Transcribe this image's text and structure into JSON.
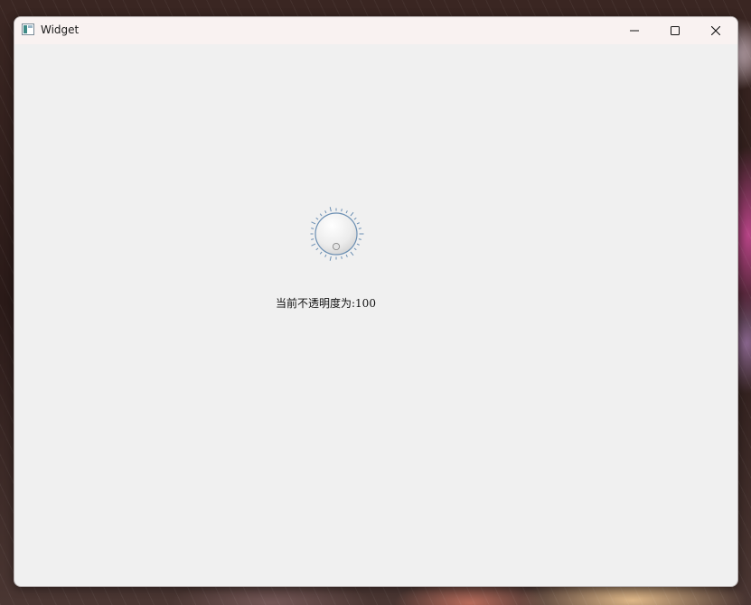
{
  "window": {
    "title": "Widget",
    "buttons": {
      "minimize": "minimize",
      "maximize": "maximize",
      "close": "close"
    }
  },
  "dial": {
    "value": 100,
    "min": 0,
    "max": 100,
    "icon": "dial-knob"
  },
  "label": {
    "text": "当前不透明度为:100"
  },
  "colors": {
    "titlebar": "#f9f2f1",
    "client": "#f0f0f0",
    "dial_ring": "#6b8fb3"
  }
}
